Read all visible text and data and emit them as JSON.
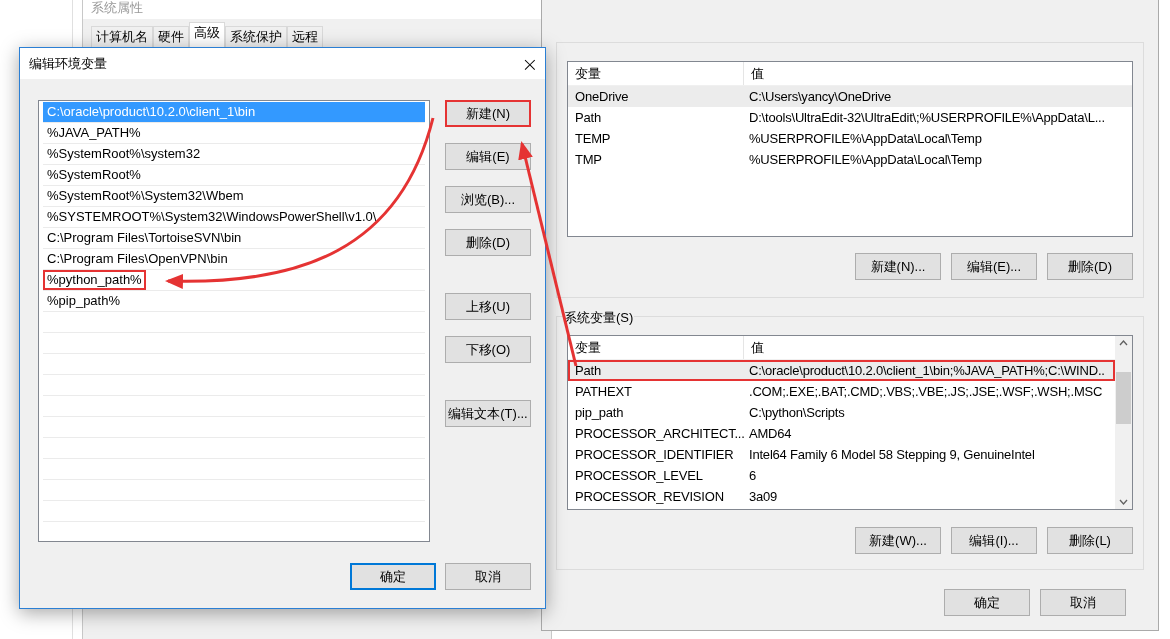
{
  "background_window": {
    "title": "系统属性",
    "tabs": [
      {
        "label": "计算机名",
        "selected": false
      },
      {
        "label": "硬件",
        "selected": false
      },
      {
        "label": "高级",
        "selected": true
      },
      {
        "label": "系统保护",
        "selected": false
      },
      {
        "label": "远程",
        "selected": false
      }
    ]
  },
  "environment_dialog": {
    "user_variables": {
      "columns": [
        "变量",
        "值"
      ],
      "rows": [
        {
          "name": "OneDrive",
          "value": "C:\\Users\\yancy\\OneDrive",
          "selected": true,
          "highlighted": false
        },
        {
          "name": "Path",
          "value": "D:\\tools\\UltraEdit-32\\UltraEdit\\;%USERPROFILE%\\AppData\\L...",
          "selected": false,
          "highlighted": false
        },
        {
          "name": "TEMP",
          "value": "%USERPROFILE%\\AppData\\Local\\Temp",
          "selected": false,
          "highlighted": false
        },
        {
          "name": "TMP",
          "value": "%USERPROFILE%\\AppData\\Local\\Temp",
          "selected": false,
          "highlighted": false
        }
      ],
      "buttons": [
        "新建(N)...",
        "编辑(E)...",
        "删除(D)"
      ]
    },
    "system_variables": {
      "label": "系统变量(S)",
      "columns": [
        "变量",
        "值"
      ],
      "rows": [
        {
          "name": "Path",
          "value": "C:\\oracle\\product\\10.2.0\\client_1\\bin;%JAVA_PATH%;C:\\WIND..",
          "selected": true,
          "highlighted": true
        },
        {
          "name": "PATHEXT",
          "value": ".COM;.EXE;.BAT;.CMD;.VBS;.VBE;.JS;.JSE;.WSF;.WSH;.MSC",
          "selected": false,
          "highlighted": false
        },
        {
          "name": "pip_path",
          "value": "C:\\python\\Scripts",
          "selected": false,
          "highlighted": false
        },
        {
          "name": "PROCESSOR_ARCHITECT...",
          "value": "AMD64",
          "selected": false,
          "highlighted": false
        },
        {
          "name": "PROCESSOR_IDENTIFIER",
          "value": "Intel64 Family 6 Model 58 Stepping 9, GenuineIntel",
          "selected": false,
          "highlighted": false
        },
        {
          "name": "PROCESSOR_LEVEL",
          "value": "6",
          "selected": false,
          "highlighted": false
        },
        {
          "name": "PROCESSOR_REVISION",
          "value": "3a09",
          "selected": false,
          "highlighted": false
        }
      ],
      "buttons": [
        "新建(W)...",
        "编辑(I)...",
        "删除(L)"
      ]
    },
    "footer_buttons": [
      "确定",
      "取消"
    ]
  },
  "edit_dialog": {
    "title": "编辑环境变量",
    "close": "×",
    "items": [
      {
        "text": "C:\\oracle\\product\\10.2.0\\client_1\\bin",
        "selected": true,
        "highlighted": false
      },
      {
        "text": "%JAVA_PATH%",
        "selected": false,
        "highlighted": false
      },
      {
        "text": "%SystemRoot%\\system32",
        "selected": false,
        "highlighted": false
      },
      {
        "text": "%SystemRoot%",
        "selected": false,
        "highlighted": false
      },
      {
        "text": "%SystemRoot%\\System32\\Wbem",
        "selected": false,
        "highlighted": false
      },
      {
        "text": "%SYSTEMROOT%\\System32\\WindowsPowerShell\\v1.0\\",
        "selected": false,
        "highlighted": false
      },
      {
        "text": "C:\\Program Files\\TortoiseSVN\\bin",
        "selected": false,
        "highlighted": false
      },
      {
        "text": "C:\\Program Files\\OpenVPN\\bin",
        "selected": false,
        "highlighted": false
      },
      {
        "text": "%python_path%",
        "selected": false,
        "highlighted": true
      },
      {
        "text": "%pip_path%",
        "selected": false,
        "highlighted": false
      }
    ],
    "buttons": [
      {
        "label": "新建(N)",
        "highlighted": true
      },
      {
        "label": "编辑(E)",
        "highlighted": false
      },
      {
        "label": "浏览(B)...",
        "highlighted": false
      },
      {
        "label": "删除(D)",
        "highlighted": false
      },
      {
        "label": "上移(U)",
        "highlighted": false
      },
      {
        "label": "下移(O)",
        "highlighted": false
      },
      {
        "label": "编辑文本(T)...",
        "highlighted": false
      }
    ],
    "footer_buttons": [
      {
        "label": "确定",
        "default": true
      },
      {
        "label": "取消",
        "default": false
      }
    ]
  }
}
